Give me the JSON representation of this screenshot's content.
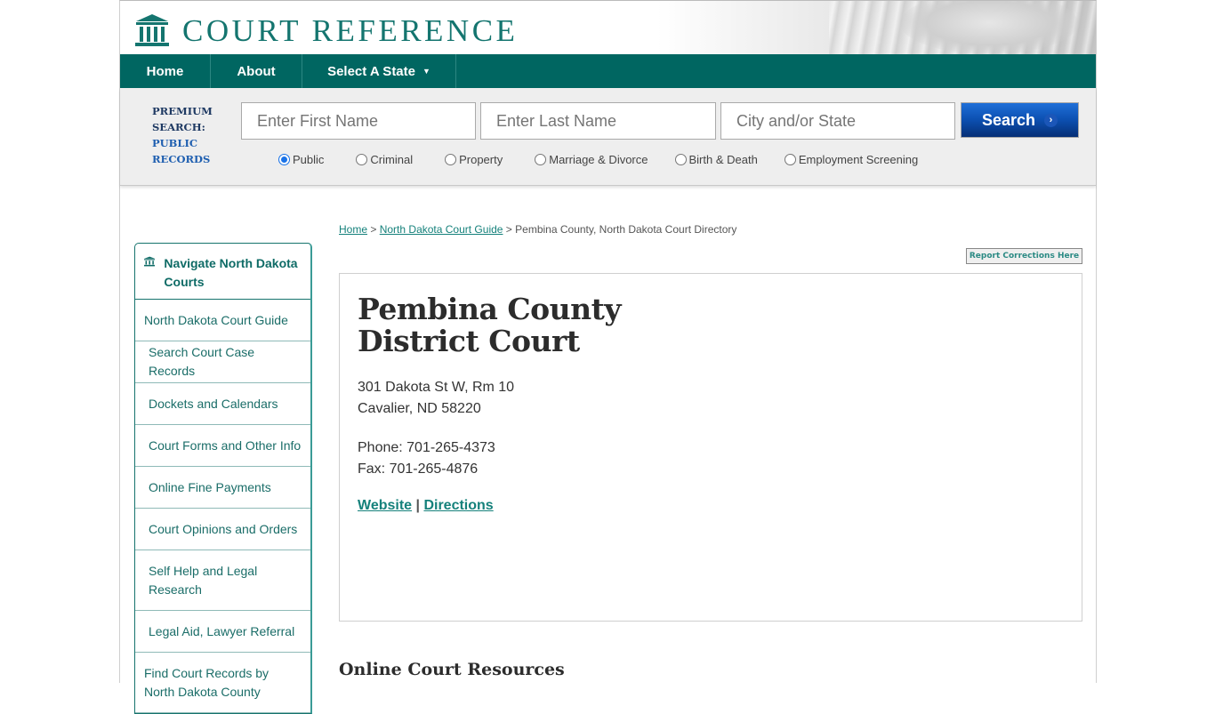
{
  "brand": {
    "name": "COURT REFERENCE",
    "accent": "#006661",
    "logo_icon": "courthouse-icon"
  },
  "nav": {
    "items": [
      {
        "label": "Home"
      },
      {
        "label": "About"
      },
      {
        "label": "Select A State",
        "icon": "caret-down-icon"
      }
    ]
  },
  "search": {
    "premium_line1": "PREMIUM",
    "premium_line2": "SEARCH:",
    "premium_line3": "PUBLIC",
    "premium_line4": "RECORDS",
    "first_name_placeholder": "Enter First Name",
    "last_name_placeholder": "Enter Last Name",
    "city_placeholder": "City and/or State",
    "button_label": "Search",
    "button_color": "#0c4fb0",
    "types": [
      {
        "label": "Public",
        "selected": true
      },
      {
        "label": "Criminal",
        "selected": false
      },
      {
        "label": "Property",
        "selected": false
      },
      {
        "label": "Marriage & Divorce",
        "selected": false
      },
      {
        "label": "Birth & Death",
        "selected": false
      },
      {
        "label": "Employment Screening",
        "selected": false
      }
    ]
  },
  "sidebar": {
    "title": "Navigate North Dakota Courts",
    "items": [
      {
        "label": "North Dakota Court Guide"
      },
      {
        "label": "Search Court Case Records"
      },
      {
        "label": "Dockets and Calendars"
      },
      {
        "label": "Court Forms and Other Info"
      },
      {
        "label": "Online Fine Payments"
      },
      {
        "label": "Court Opinions and Orders"
      },
      {
        "label": "Self Help and Legal Research"
      },
      {
        "label": "Legal Aid, Lawyer Referral"
      },
      {
        "label": "Find Court Records by North Dakota County"
      }
    ]
  },
  "breadcrumb": {
    "home": "Home",
    "sep": ">",
    "guide": "North Dakota Court Guide",
    "current": "Pembina County, North Dakota Court Directory"
  },
  "report_button": "Report Corrections Here",
  "court": {
    "name_line1": "Pembina County",
    "name_line2": "District Court",
    "address_line1": "301 Dakota St W, Rm 10",
    "address_line2": "Cavalier, ND 58220",
    "phone": "Phone: 701-265-4373",
    "fax": "Fax: 701-265-4876",
    "website_label": "Website",
    "link_sep": "|",
    "directions_label": "Directions"
  },
  "resources_heading": "Online Court Resources"
}
